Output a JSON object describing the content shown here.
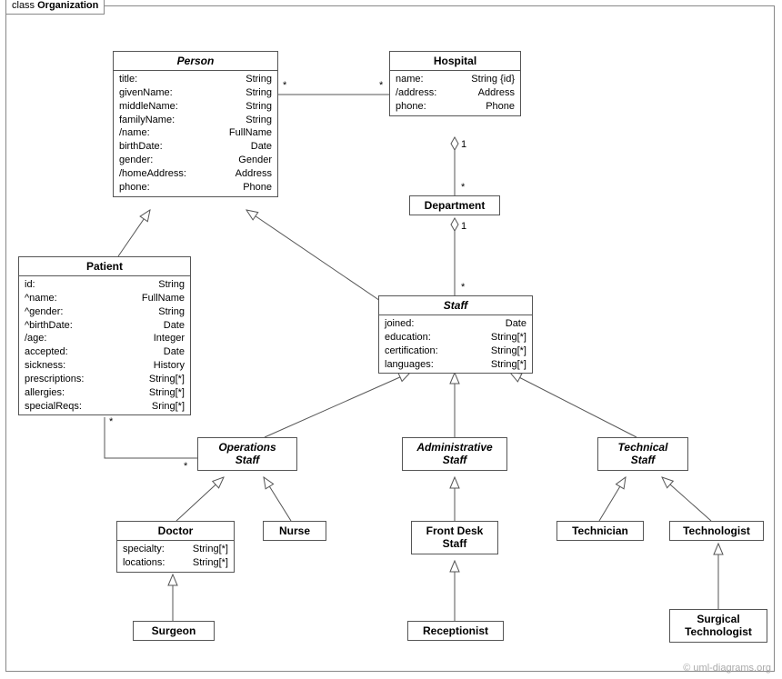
{
  "frame_label_prefix": "class",
  "frame_label_bold": "Organization",
  "copyright": "© uml-diagrams.org",
  "classes": {
    "person": {
      "title": "Person",
      "attrs": [
        [
          "title:",
          "String"
        ],
        [
          "givenName:",
          "String"
        ],
        [
          "middleName:",
          "String"
        ],
        [
          "familyName:",
          "String"
        ],
        [
          "/name:",
          "FullName"
        ],
        [
          "birthDate:",
          "Date"
        ],
        [
          "gender:",
          "Gender"
        ],
        [
          "/homeAddress:",
          "Address"
        ],
        [
          "phone:",
          "Phone"
        ]
      ]
    },
    "hospital": {
      "title": "Hospital",
      "attrs": [
        [
          "name:",
          "String {id}"
        ],
        [
          "/address:",
          "Address"
        ],
        [
          "phone:",
          "Phone"
        ]
      ]
    },
    "department": {
      "title": "Department"
    },
    "patient": {
      "title": "Patient",
      "attrs": [
        [
          "id:",
          "String"
        ],
        [
          "^name:",
          "FullName"
        ],
        [
          "^gender:",
          "String"
        ],
        [
          "^birthDate:",
          "Date"
        ],
        [
          "/age:",
          "Integer"
        ],
        [
          "accepted:",
          "Date"
        ],
        [
          "sickness:",
          "History"
        ],
        [
          "prescriptions:",
          "String[*]"
        ],
        [
          "allergies:",
          "String[*]"
        ],
        [
          "specialReqs:",
          "Sring[*]"
        ]
      ]
    },
    "staff": {
      "title": "Staff",
      "attrs": [
        [
          "joined:",
          "Date"
        ],
        [
          "education:",
          "String[*]"
        ],
        [
          "certification:",
          "String[*]"
        ],
        [
          "languages:",
          "String[*]"
        ]
      ]
    },
    "operationsStaff": {
      "title": "Operations\nStaff"
    },
    "administrativeStaff": {
      "title": "Administrative\nStaff"
    },
    "technicalStaff": {
      "title": "Technical\nStaff"
    },
    "doctor": {
      "title": "Doctor",
      "attrs": [
        [
          "specialty:",
          "String[*]"
        ],
        [
          "locations:",
          "String[*]"
        ]
      ]
    },
    "nurse": {
      "title": "Nurse"
    },
    "frontDeskStaff": {
      "title": "Front Desk\nStaff"
    },
    "technician": {
      "title": "Technician"
    },
    "technologist": {
      "title": "Technologist"
    },
    "surgeon": {
      "title": "Surgeon"
    },
    "receptionist": {
      "title": "Receptionist"
    },
    "surgicalTechnologist": {
      "title": "Surgical\nTechnologist"
    }
  },
  "multiplicities": {
    "person_hospital_left": "*",
    "person_hospital_right": "*",
    "hospital_dept_top": "1",
    "hospital_dept_bot": "*",
    "dept_staff_top": "1",
    "dept_staff_bot": "*",
    "patient_ops_left": "*",
    "patient_ops_right": "*"
  }
}
